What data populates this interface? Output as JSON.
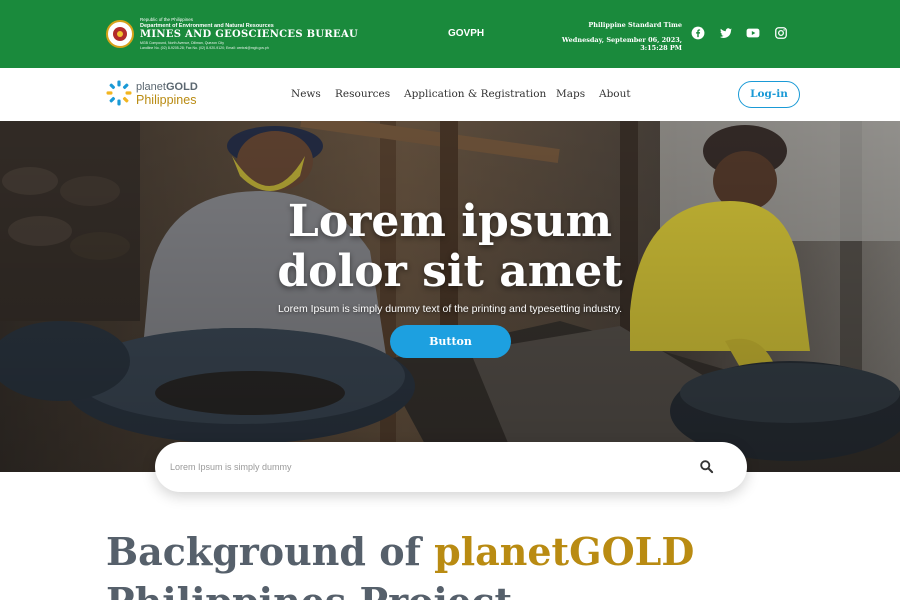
{
  "gov_bar": {
    "agency": {
      "line1": "Republic of the Philippines",
      "line2": "Department of Environment and Natural Resources",
      "name": "MINES AND GEOSCIENCES BUREAU",
      "address": "MGB Compound, North Avenue, Diliman, Quezon City",
      "contact": "Landline No. (02) 8-9205-28; Fax No. (02) 8-920-9120; Email: central@mgb.gov.ph"
    },
    "govph_label": "GOVPH",
    "time_label": "Philippine Standard Time",
    "datetime": "Wednesday, September 06, 2023, 3:15:28 PM",
    "social_icons": [
      "facebook-icon",
      "twitter-icon",
      "youtube-icon",
      "instagram-icon"
    ],
    "color": "#1a8a3c"
  },
  "nav": {
    "logo": {
      "line1_prefix": "planet",
      "line1_bold": "GOLD",
      "line2": "Philippines"
    },
    "links": [
      "News",
      "Resources",
      "Application & Registration",
      "Maps",
      "About"
    ],
    "login_label": "Log-in",
    "accent": "#1a9ad6"
  },
  "hero": {
    "title_line1": "Lorem ipsum",
    "title_line2": "dolor sit amet",
    "subtitle": "Lorem Ipsum is simply dummy text of the printing and typesetting industry.",
    "button_label": "Button",
    "button_color": "#1da0e0"
  },
  "search": {
    "placeholder": "Lorem Ipsum is simply dummy",
    "icon": "search-icon"
  },
  "section": {
    "title_part1": "Background of ",
    "title_highlight": "planetGOLD",
    "title_line2": "Philippines Project",
    "gold_color": "#b98b12",
    "gray_color": "#56606b"
  }
}
